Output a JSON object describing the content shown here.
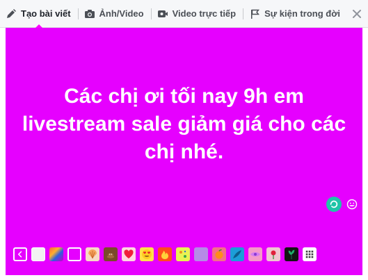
{
  "tabs": [
    {
      "label": "Tạo bài viết",
      "icon": "pencil-icon",
      "active": true
    },
    {
      "label": "Ảnh/Video",
      "icon": "camera-icon",
      "active": false
    },
    {
      "label": "Video trực tiếp",
      "icon": "video-camera-icon",
      "active": false
    },
    {
      "label": "Sự kiện trong đời",
      "icon": "flag-icon",
      "active": false
    }
  ],
  "composer": {
    "text": "Các chị ơi tối nay 9h em\nlivestream sale giảm giá cho các\nchị nhé.",
    "background_color": "#e600ff"
  },
  "backgrounds": {
    "count_visible": 18,
    "swatches": [
      {
        "name": "back-arrow"
      },
      {
        "name": "plain-white"
      },
      {
        "name": "gradient-pattern"
      },
      {
        "name": "magenta-selected"
      },
      {
        "name": "shell"
      },
      {
        "name": "poop-emoji"
      },
      {
        "name": "heart"
      },
      {
        "name": "heart-eyes-emoji"
      },
      {
        "name": "fire"
      },
      {
        "name": "yellow-pattern"
      },
      {
        "name": "purple-pattern"
      },
      {
        "name": "orange-fruit"
      },
      {
        "name": "blue-leaves"
      },
      {
        "name": "pink-eye"
      },
      {
        "name": "rose"
      },
      {
        "name": "dark-plant"
      },
      {
        "name": "grid-more"
      }
    ]
  },
  "colors": {
    "accent": "#e600ff",
    "teal": "#20c4a8",
    "tab_bar": "#f6f7f9"
  }
}
